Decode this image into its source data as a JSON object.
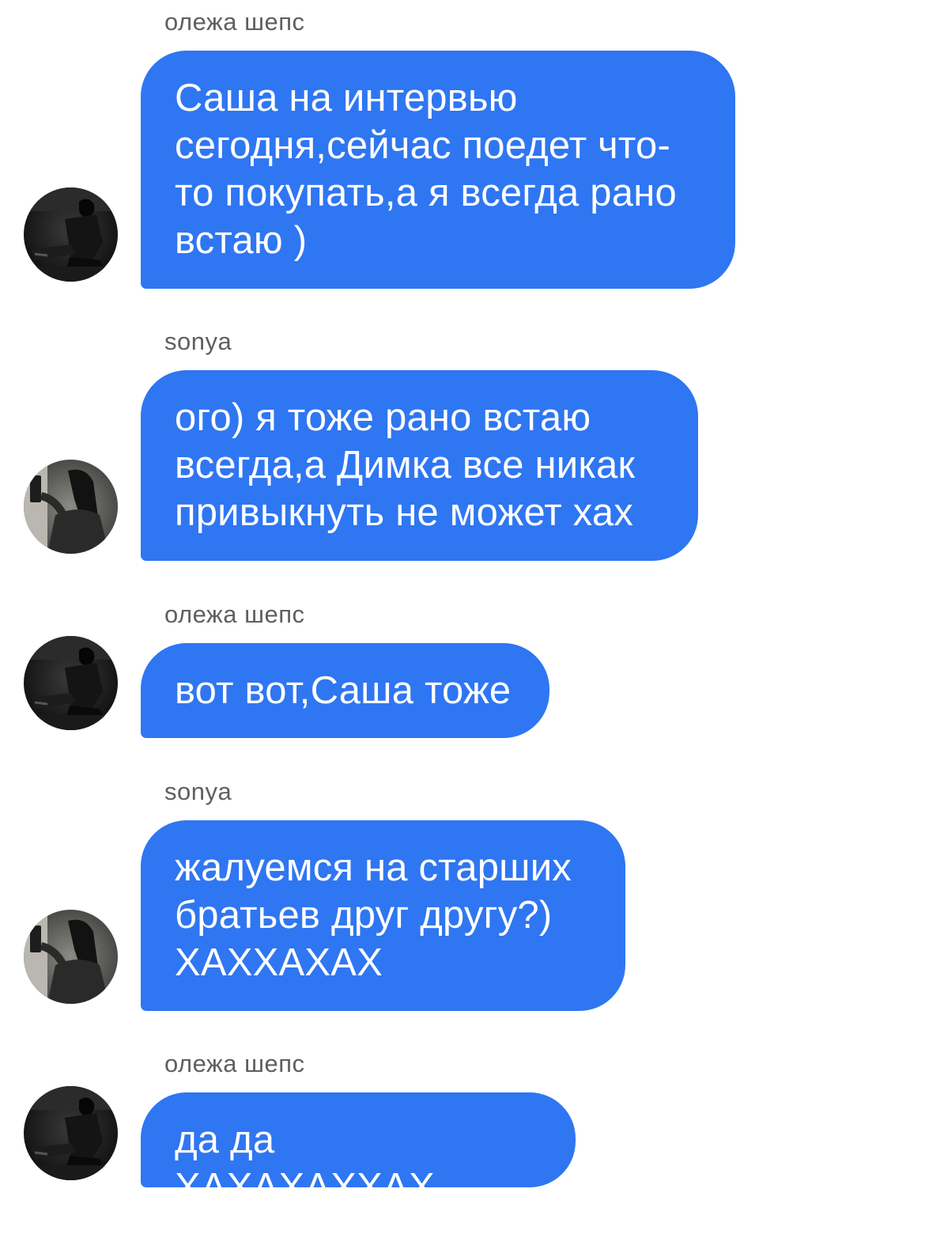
{
  "chat": {
    "messages": [
      {
        "sender": "олежа шепс",
        "text": "Саша на интервью\nсегодня,сейчас поедет что-\nто покупать,а я всегда рано\nвстаю )",
        "avatar": "avatar-oleg"
      },
      {
        "sender": "sonya",
        "text": "ого) я тоже рано встаю\nвсегда,а Димка все никак\nпривыкнуть не может хах",
        "avatar": "avatar-sonya"
      },
      {
        "sender": "олежа шепс",
        "text": "вот вот,Саша тоже",
        "avatar": "avatar-oleg"
      },
      {
        "sender": "sonya",
        "text": "жалуемся на старших\nбратьев друг другу?)\nХАХХАХАХ",
        "avatar": "avatar-sonya"
      },
      {
        "sender": "олежа шепс",
        "text": "да да ХАХАХАХХАХ",
        "avatar": "avatar-oleg"
      }
    ]
  },
  "colors": {
    "bubble": "#2f76f2",
    "bubble_text": "#ffffff",
    "sender_text": "#5f5f5f",
    "background": "#ffffff"
  }
}
